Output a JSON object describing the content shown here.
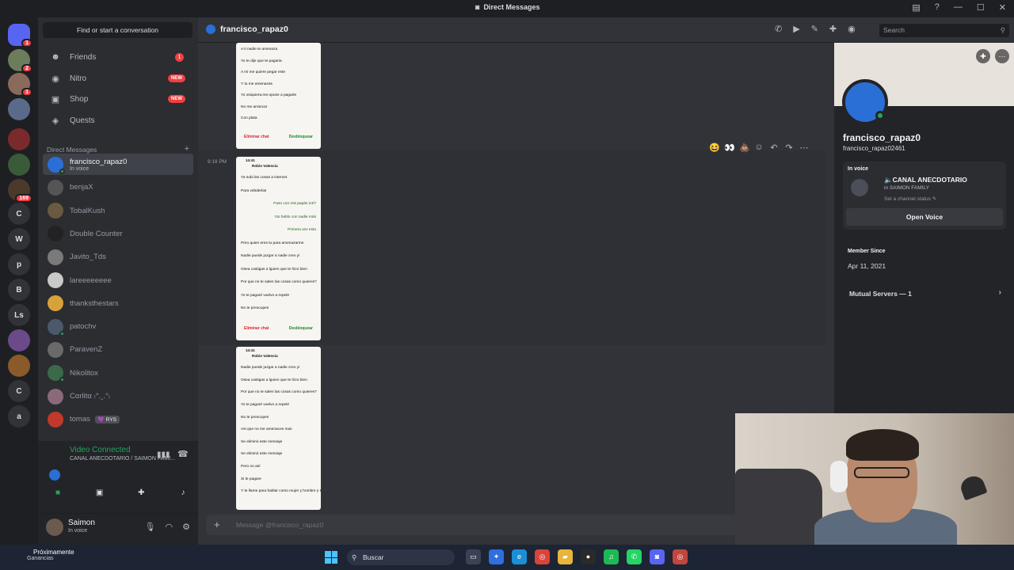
{
  "window": {
    "title": "Direct Messages"
  },
  "servers": [
    {
      "label": "",
      "badge": "1"
    },
    {
      "label": "",
      "badge": "2"
    },
    {
      "label": "",
      "badge": "1"
    },
    {
      "label": "",
      "badge": ""
    },
    {
      "label": "",
      "badge": ""
    },
    {
      "label": "",
      "badge": ""
    },
    {
      "label": "",
      "badge": "169"
    },
    {
      "label": "C",
      "badge": ""
    },
    {
      "label": "W",
      "badge": ""
    },
    {
      "label": "p",
      "badge": ""
    },
    {
      "label": "B",
      "badge": ""
    },
    {
      "label": "Ls",
      "badge": ""
    },
    {
      "label": "",
      "badge": ""
    },
    {
      "label": "",
      "badge": ""
    },
    {
      "label": "C",
      "badge": ""
    },
    {
      "label": "a",
      "badge": ""
    }
  ],
  "sidebar": {
    "find": "Find or start a conversation",
    "nav": [
      {
        "label": "Friends",
        "icon": "friends-icon",
        "glyph": "☻",
        "pill": "1",
        "pill_type": "num"
      },
      {
        "label": "Nitro",
        "icon": "nitro-icon",
        "glyph": "◉",
        "pill": "NEW",
        "pill_type": "new"
      },
      {
        "label": "Shop",
        "icon": "shop-icon",
        "glyph": "▣",
        "pill": "NEW",
        "pill_type": "new"
      },
      {
        "label": "Quests",
        "icon": "quests-icon",
        "glyph": "◈",
        "pill": "",
        "pill_type": ""
      }
    ],
    "dm_header": "Direct Messages",
    "dms": [
      {
        "name": "francisco_rapaz0",
        "sub": "In voice",
        "active": true,
        "tag": ""
      },
      {
        "name": "benjaX",
        "sub": "",
        "active": false,
        "tag": ""
      },
      {
        "name": "TobalKush",
        "sub": "",
        "active": false,
        "tag": ""
      },
      {
        "name": "Double Counter",
        "sub": "",
        "active": false,
        "tag": ""
      },
      {
        "name": "Javito_Tds",
        "sub": "",
        "active": false,
        "tag": ""
      },
      {
        "name": "lareeeeeeee",
        "sub": "",
        "active": false,
        "tag": ""
      },
      {
        "name": "thanksthestars",
        "sub": "",
        "active": false,
        "tag": ""
      },
      {
        "name": "patochv",
        "sub": "",
        "active": false,
        "tag": ""
      },
      {
        "name": "ParavenZ",
        "sub": "",
        "active": false,
        "tag": ""
      },
      {
        "name": "Nikolitox",
        "sub": "",
        "active": false,
        "tag": ""
      },
      {
        "name": "Cαrlitα ₍ᐢ.ˬ.ᐢ₎",
        "sub": "",
        "active": false,
        "tag": ""
      },
      {
        "name": "tomas",
        "sub": "",
        "active": false,
        "tag": "💜 RYS"
      }
    ],
    "voice": {
      "title": "Video Connected",
      "sub": "CANAL ANECDOTARIO / SAIMON FAMI..."
    },
    "user": {
      "name": "Saimon",
      "status": "In voice"
    }
  },
  "chat": {
    "header_name": "francisco_rapaz0",
    "search_placeholder": "Search",
    "timestamp": "9:18 PM",
    "composer_placeholder": "Message @francisco_rapaz0",
    "screenshots": [
      {
        "lines": [
          {
            "t": "A ti nadie te amenaza",
            "me": false
          },
          {
            "t": "Yo te dije que te pagaria",
            "me": false
          },
          {
            "t": "A mi me quiere pegar este",
            "me": false
          },
          {
            "t": "Y tu me amenazas",
            "me": false
          },
          {
            "t": "Yo osiquiera.me.opuse a pagarte",
            "me": false
          },
          {
            "t": "No me arrancar",
            "me": false
          },
          {
            "t": "Con plata",
            "me": false
          }
        ],
        "delete": "Eliminar chat",
        "unblock": "Desbloquear"
      },
      {
        "clock": "14:41",
        "contact": "Robin Valencia",
        "lines": [
          {
            "t": "Ya subi las cosas a internet",
            "me": false
          },
          {
            "t": "Para vebderlas",
            "me": false
          },
          {
            "t": "Paso con mis papás 24/7",
            "me": true
          },
          {
            "t": "No hablo con nadie más",
            "me": true
          },
          {
            "t": "Primera vez esto",
            "me": true
          },
          {
            "t": "Pero quien eres tu para amenazarme",
            "me": false
          },
          {
            "t": "Nadie puede juzgar a nadie creo yi",
            "me": false
          },
          {
            "t": "Osea castigas a lguien que te hizo bien",
            "me": false
          },
          {
            "t": "Por que no te salen las cosas como quieres?",
            "me": false
          },
          {
            "t": "Yo te pagaré vuelvo a repetir",
            "me": false
          },
          {
            "t": "No te preocupes",
            "me": false
          }
        ],
        "delete": "Eliminar chat",
        "unblock": "Desbloquear"
      },
      {
        "clock": "14:41",
        "contact": "Robin Valencia",
        "lines": [
          {
            "t": "Nadie puede juzgar a nadie creo yi",
            "me": false
          },
          {
            "t": "Osea castigas a lguien que te hizo bien",
            "me": false
          },
          {
            "t": "Por que no te salen las cosas como quieres?",
            "me": false
          },
          {
            "t": "Yo te pagaré vuelvo a repetir",
            "me": false
          },
          {
            "t": "No te preocupes",
            "me": false
          },
          {
            "t": "Asi que no me amenaces mas",
            "me": false
          },
          {
            "t": "Se eliminó este mensaje",
            "me": false
          },
          {
            "t": "Se eliminó este mensaje",
            "me": false
          },
          {
            "t": "Pero no así",
            "me": false
          },
          {
            "t": "Si te pagare",
            "me": false
          },
          {
            "t": "Y te llame para hablar como mujer y hombre y tu contestas te desconectas como cobarde y para que",
            "me": false
          }
        ],
        "delete": "",
        "unblock": ""
      }
    ],
    "reactions": [
      "😆",
      "👀",
      "💩"
    ]
  },
  "profile": {
    "name": "francisco_rapaz0",
    "tag": "francisco_rapaz02461",
    "in_voice_label": "In voice",
    "channel": "🔈CANAL ANECDOTARIO",
    "server": "in SAIMON FAMILY",
    "set_status": "Set a channel status ✎",
    "open_voice": "Open Voice",
    "member_since_label": "Member Since",
    "member_since": "Apr 11, 2021",
    "mutual": "Mutual Servers — 1"
  },
  "taskbar": {
    "weather": "Próximamente",
    "weather_sub": "Ganancias",
    "search": "Buscar"
  },
  "colors": {
    "accent": "#5865f2",
    "online": "#23a55a",
    "danger": "#f23f43"
  }
}
